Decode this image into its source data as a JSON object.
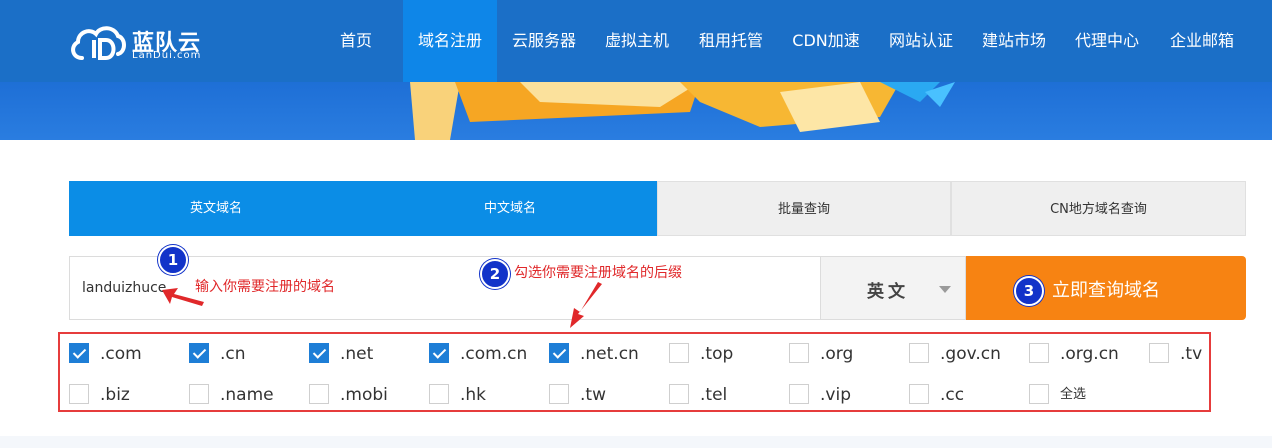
{
  "header": {
    "logo_text": "蓝队云",
    "logo_sub": "LanDui.com",
    "nav": [
      "首页",
      "域名注册",
      "云服务器",
      "虚拟主机",
      "租用托管",
      "CDN加速",
      "网站认证",
      "建站市场",
      "代理中心",
      "企业邮箱"
    ],
    "active_nav": "域名注册",
    "accent_color": "#1b6fc7"
  },
  "tabs": [
    "英文域名",
    "中文域名",
    "批量查询",
    "CN地方域名查询"
  ],
  "search": {
    "value": "landuizhuce",
    "language": "英文",
    "button_label": "立即查询域名",
    "button_color": "#f78312"
  },
  "steps": {
    "one": "1",
    "two": "2",
    "three": "3"
  },
  "annotations": {
    "note1": "输入你需要注册的域名",
    "note2": "勾选你需要注册域名的后缀"
  },
  "suffixes": [
    {
      "label": ".com",
      "checked": true
    },
    {
      "label": ".cn",
      "checked": true
    },
    {
      "label": ".net",
      "checked": true
    },
    {
      "label": ".com.cn",
      "checked": true
    },
    {
      "label": ".net.cn",
      "checked": true
    },
    {
      "label": ".top",
      "checked": false
    },
    {
      "label": ".org",
      "checked": false
    },
    {
      "label": ".gov.cn",
      "checked": false
    },
    {
      "label": ".org.cn",
      "checked": false
    },
    {
      "label": ".tv",
      "checked": false
    },
    {
      "label": ".biz",
      "checked": false
    },
    {
      "label": ".name",
      "checked": false
    },
    {
      "label": ".mobi",
      "checked": false
    },
    {
      "label": ".hk",
      "checked": false
    },
    {
      "label": ".tw",
      "checked": false
    },
    {
      "label": ".tel",
      "checked": false
    },
    {
      "label": ".vip",
      "checked": false
    },
    {
      "label": ".cc",
      "checked": false
    },
    {
      "label": "全选",
      "checked": false
    }
  ]
}
